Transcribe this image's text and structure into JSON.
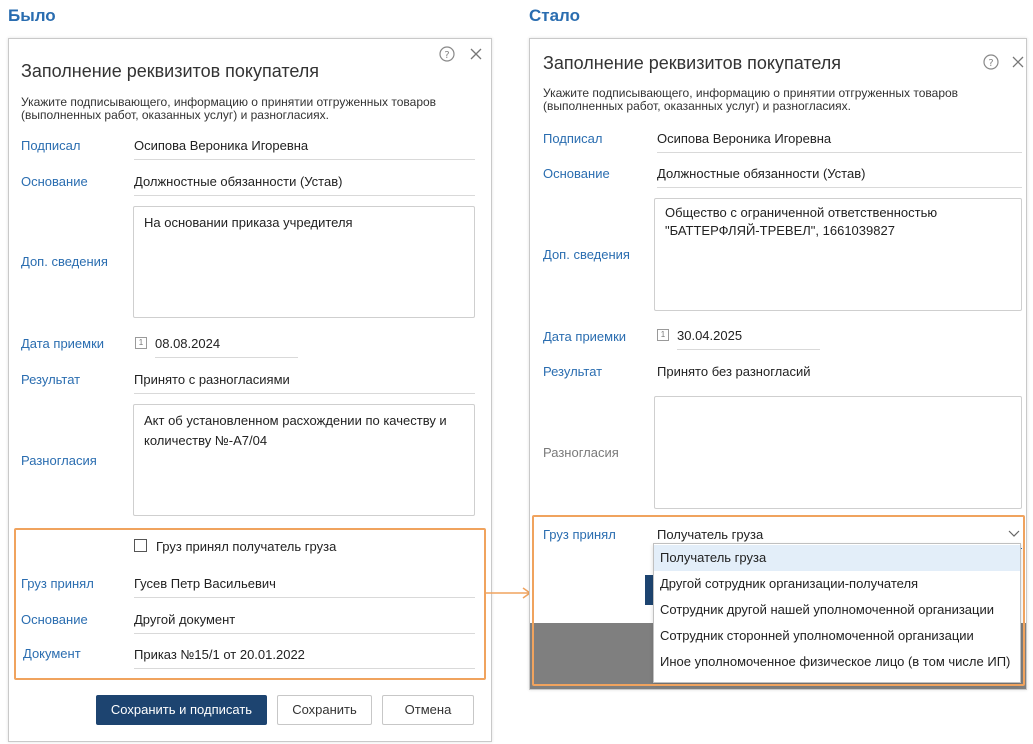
{
  "before": {
    "heading": "Было",
    "dialog": {
      "title": "Заполнение реквизитов покупателя",
      "description_line1": "Укажите подписывающего, информацию о принятии отгруженных товаров",
      "description_line2": "(выполненных работ, оказанных услуг) и разногласиях.",
      "fields": {
        "signed_label": "Подписал",
        "signed_value": "Осипова Вероника Игоревна",
        "basis_label": "Основание",
        "basis_value": "Должностные обязанности (Устав)",
        "extra_label": "Доп. сведения",
        "extra_value": "На основании приказа учредителя",
        "date_label": "Дата приемки",
        "date_value": "08.08.2024",
        "result_label": "Результат",
        "result_value": "Принято с разногласиями",
        "disagreements_label": "Разногласия",
        "disagreements_line1": "Акт об установленном расхождении по качеству и",
        "disagreements_line2": "количеству №-А7/04"
      },
      "cargo": {
        "checkbox_label": "Груз принял получатель груза",
        "received_label": "Груз принял",
        "received_value": "Гусев Петр Васильевич",
        "basis_label": "Основание",
        "basis_value": "Другой документ",
        "document_label": "Документ",
        "document_value": "Приказ №15/1 от 20.01.2022"
      },
      "buttons": {
        "save_sign": "Сохранить и подписать",
        "save": "Сохранить",
        "cancel": "Отмена"
      }
    }
  },
  "after": {
    "heading": "Стало",
    "dialog": {
      "title": "Заполнение реквизитов покупателя",
      "description_line1": "Укажите подписывающего, информацию о принятии отгруженных товаров",
      "description_line2": "(выполненных работ, оказанных услуг) и разногласиях.",
      "fields": {
        "signed_label": "Подписал",
        "signed_value": "Осипова Вероника Игоревна",
        "basis_label": "Основание",
        "basis_value": "Должностные обязанности (Устав)",
        "extra_label": "Доп. сведения",
        "extra_line1": "Общество с ограниченной ответственностью",
        "extra_line2": "\"БАТТЕРФЛЯЙ-ТРЕВЕЛ\", 1661039827",
        "date_label": "Дата приемки",
        "date_value": "30.04.2025",
        "result_label": "Результат",
        "result_value": "Принято без разногласий",
        "disagreements_label": "Разногласия"
      },
      "cargo": {
        "received_label": "Груз принял",
        "selected_value": "Получатель груза",
        "options": [
          "Получатель груза",
          "Другой сотрудник организации-получателя",
          "Сотрудник другой нашей уполномоченной организации",
          "Сотрудник сторонней уполномоченной организации",
          "Иное уполномоченное физическое лицо (в том числе ИП)"
        ]
      }
    }
  },
  "colors": {
    "accent": "#2a6db0",
    "highlight": "#f0a35e",
    "primary_button": "#1d4470"
  }
}
